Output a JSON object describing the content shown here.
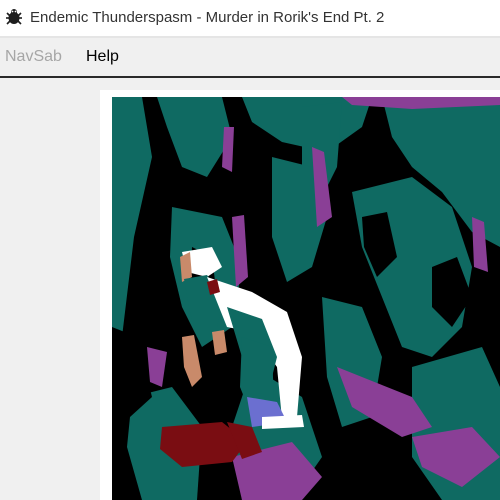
{
  "window": {
    "title": "Endemic Thunderspasm - Murder in Rorik's End Pt. 2",
    "icon": "bug-icon"
  },
  "menu": {
    "items": [
      {
        "label": "NavSab",
        "enabled": false
      },
      {
        "label": "Help",
        "enabled": true
      }
    ]
  },
  "scene": {
    "icon": "game-scene-image",
    "colors": {
      "background": "#000000",
      "teal": "#0f6a62",
      "purple": "#8a3f96",
      "white": "#ffffff",
      "red": "#7a0d12",
      "skin": "#c98a6a",
      "blue": "#6b6fd0"
    }
  }
}
